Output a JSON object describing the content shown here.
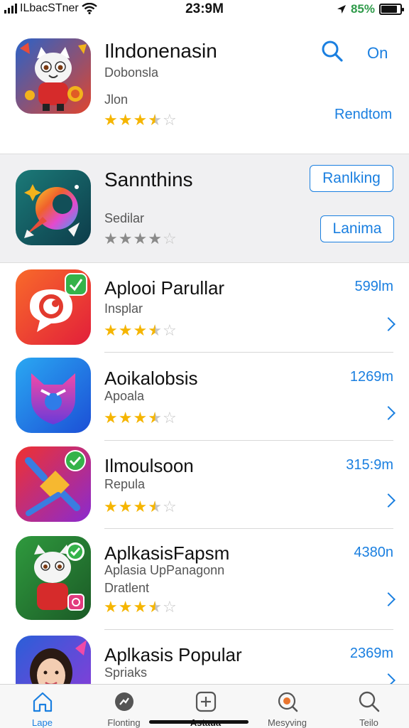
{
  "status_bar": {
    "carrier": "ILbacSTner",
    "time": "23:9M",
    "battery": "85%",
    "battery_level": 0.85
  },
  "featured": {
    "title": "Ilndonenasin",
    "subtitle": "Dobonsla",
    "category": "Jlon",
    "rating": 3.5,
    "search_icon": "search-icon",
    "on_label": "On",
    "action_link": "Rendtom"
  },
  "section": {
    "title": "Sannthins",
    "subtitle": "Sedilar",
    "rating": 4,
    "ranking_button": "Ranlking",
    "lanima_button": "Lanima"
  },
  "apps": [
    {
      "title": "Aplooi Parullar",
      "subtitle": "Insplar",
      "extra": "",
      "size": "599lm",
      "rating": 3.5
    },
    {
      "title": "Aoikalobsis",
      "subtitle": "Apoala",
      "extra": "",
      "size": "1269m",
      "rating": 3.5
    },
    {
      "title": "Ilmoulsoon",
      "subtitle": "Repula",
      "extra": "",
      "size": "315:9m",
      "rating": 3.5
    },
    {
      "title": "AplkasisFapsm",
      "subtitle": "Aplasia UpPanagonn",
      "extra": "Dratlent",
      "size": "4380n",
      "rating": 3.5
    },
    {
      "title": "Aplkasis Popular",
      "subtitle": "Spriaks",
      "extra": "",
      "size": "2369m",
      "rating": 0
    }
  ],
  "tabs": [
    {
      "label": "Lape",
      "icon": "home-icon",
      "active": true
    },
    {
      "label": "Flonting",
      "icon": "chat-icon",
      "active": false
    },
    {
      "label": "Astaua",
      "icon": "add-icon",
      "active": false
    },
    {
      "label": "Mesyving",
      "icon": "target-icon",
      "active": false
    },
    {
      "label": "Teilo",
      "icon": "search-icon",
      "active": false
    }
  ],
  "colors": {
    "accent": "#1a7fe0",
    "star": "#f5b500",
    "battery_text": "#2f9b4a",
    "section_bg": "#f0f0f2"
  }
}
